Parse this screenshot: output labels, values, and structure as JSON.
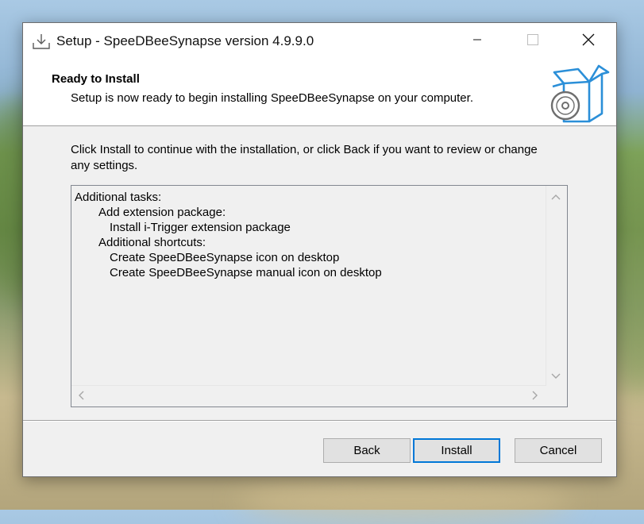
{
  "window": {
    "title": "Setup - SpeeDBeeSynapse version 4.9.9.0",
    "icons": [
      "setup-icon",
      "minimize-icon",
      "maximize-icon",
      "close-icon"
    ]
  },
  "header": {
    "title": "Ready to Install",
    "subtitle": "Setup is now ready to begin installing SpeeDBeeSynapse on your computer.",
    "icon": "install-box-icon"
  },
  "instructions": "Click Install to continue with the installation, or click Back if you want to review or change any settings.",
  "memo": {
    "lines": [
      {
        "text": "Additional tasks:",
        "indent": 0
      },
      {
        "text": "Add extension package:",
        "indent": 1
      },
      {
        "text": "Install i-Trigger extension package",
        "indent": 2
      },
      {
        "text": "Additional shortcuts:",
        "indent": 1
      },
      {
        "text": "Create SpeeDBeeSynapse icon on desktop",
        "indent": 2
      },
      {
        "text": "Create SpeeDBeeSynapse manual icon on desktop",
        "indent": 2
      }
    ]
  },
  "buttons": {
    "back": "Back",
    "install": "Install",
    "cancel": "Cancel"
  },
  "colors": {
    "accent": "#0078d7",
    "icon_blue": "#2b8fd8"
  }
}
